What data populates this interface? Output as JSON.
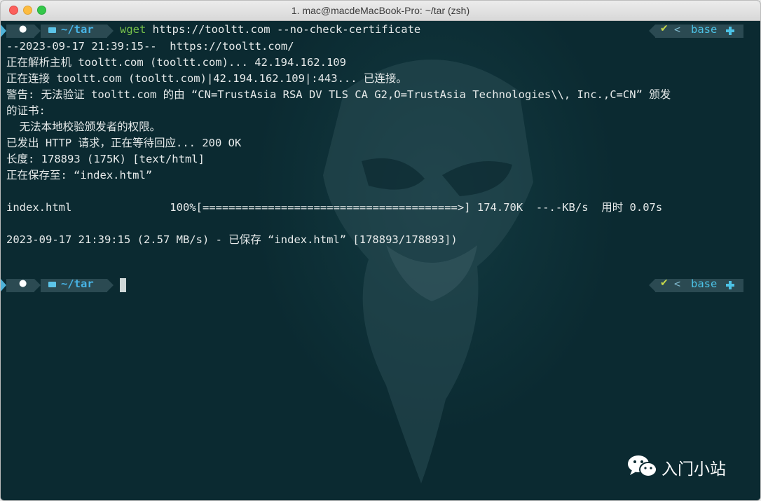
{
  "window": {
    "title": "1. mac@macdeMacBook-Pro: ~/tar (zsh)"
  },
  "prompt": {
    "dir": "~/tar",
    "env": "base"
  },
  "command": {
    "name": "wget",
    "args": " https://tooltt.com --no-check-certificate"
  },
  "output": [
    "--2023-09-17 21:39:15--  https://tooltt.com/",
    "正在解析主机 tooltt.com (tooltt.com)... 42.194.162.109",
    "正在连接 tooltt.com (tooltt.com)|42.194.162.109|:443... 已连接。",
    "警告: 无法验证 tooltt.com 的由 “CN=TrustAsia RSA DV TLS CA G2,O=TrustAsia Technologies\\\\, Inc.,C=CN” 颁发",
    "的证书:",
    "  无法本地校验颁发者的权限。",
    "已发出 HTTP 请求，正在等待回应... 200 OK",
    "长度: 178893 (175K) [text/html]",
    "正在保存至: “index.html”",
    "",
    "index.html               100%[=======================================>] 174.70K  --.-KB/s  用时 0.07s",
    "",
    "2023-09-17 21:39:15 (2.57 MB/s) - 已保存 “index.html” [178893/178893])"
  ],
  "watermark": {
    "text": "入门小站"
  },
  "colors": {
    "background": "#0b2a31",
    "dir": "#47b4e6",
    "command": "#77c24a",
    "env": "#4cc3e6"
  }
}
